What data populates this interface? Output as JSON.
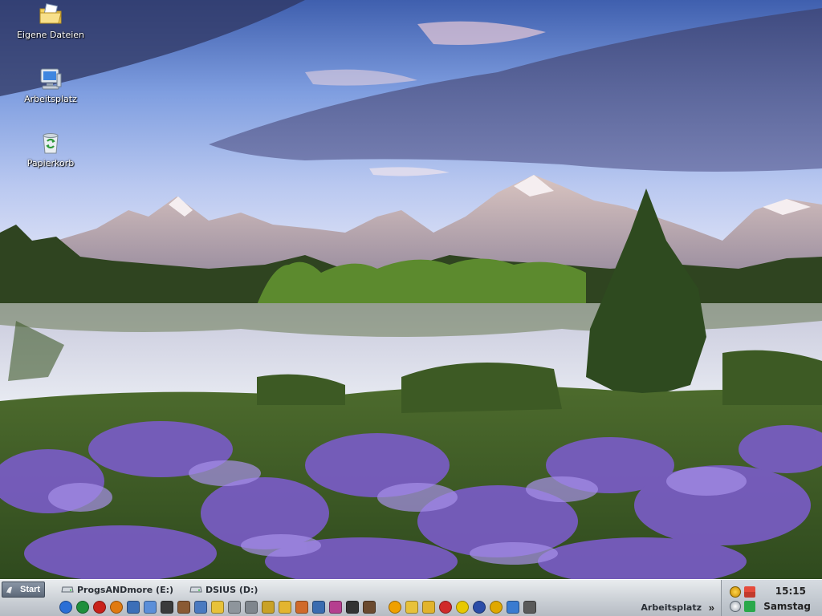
{
  "desktop": {
    "icons": [
      {
        "label": "Eigene Dateien",
        "icon": "folder-documents-icon"
      },
      {
        "label": "Arbeitsplatz",
        "icon": "computer-icon"
      },
      {
        "label": "Papierkorb",
        "icon": "recycle-bin-icon"
      }
    ]
  },
  "taskbar": {
    "start_label": "Start",
    "drives": [
      {
        "label": "ProgsANDmore (E:)",
        "icon": "drive-icon"
      },
      {
        "label": "DSIUS (D:)",
        "icon": "drive-icon"
      }
    ],
    "toolbar_label": "Arbeitsplatz",
    "more_label": "»",
    "quick_launch": [
      {
        "icon": "ie-icon",
        "color": "#2b6fd6"
      },
      {
        "icon": "globe-icon",
        "color": "#1e8f3c"
      },
      {
        "icon": "opera-icon",
        "color": "#c9221b"
      },
      {
        "icon": "firefox-icon",
        "color": "#e07a10"
      },
      {
        "icon": "thunderbird-icon",
        "color": "#3c6fb8"
      },
      {
        "icon": "messenger-icon",
        "color": "#5b8fd9"
      },
      {
        "icon": "tool-icon",
        "color": "#3b3b3b"
      },
      {
        "icon": "gallery-icon",
        "color": "#8a5a33"
      },
      {
        "icon": "window-icon",
        "color": "#4a7ac0"
      },
      {
        "icon": "folder-icon",
        "color": "#e8c23a"
      },
      {
        "icon": "drive-icon",
        "color": "#8e959c"
      },
      {
        "icon": "drive2-icon",
        "color": "#7f868d"
      },
      {
        "icon": "pen-icon",
        "color": "#c9a227"
      },
      {
        "icon": "folder2-icon",
        "color": "#e3b530"
      },
      {
        "icon": "settings-icon",
        "color": "#d06a2a"
      },
      {
        "icon": "screen-icon",
        "color": "#3a6cb0"
      },
      {
        "icon": "paint-icon",
        "color": "#b53f8f"
      },
      {
        "icon": "camera-icon",
        "color": "#333333"
      },
      {
        "icon": "person-icon",
        "color": "#6b4a2f"
      },
      {
        "icon": "gap",
        "color": "transparent"
      },
      {
        "icon": "sun-icon",
        "color": "#f0a000"
      },
      {
        "icon": "folder3-icon",
        "color": "#e8c23a"
      },
      {
        "icon": "folder4-icon",
        "color": "#e2b42c"
      },
      {
        "icon": "media-icon",
        "color": "#d02a2a"
      },
      {
        "icon": "smiley-icon",
        "color": "#e8c900"
      },
      {
        "icon": "winamp-icon",
        "color": "#2b4da8"
      },
      {
        "icon": "smiley2-icon",
        "color": "#e0a800"
      },
      {
        "icon": "network-icon",
        "color": "#3a7bd0"
      },
      {
        "icon": "printer-icon",
        "color": "#5a5a5a"
      }
    ]
  },
  "tray": {
    "time": "15:15",
    "day": "Samstag"
  }
}
